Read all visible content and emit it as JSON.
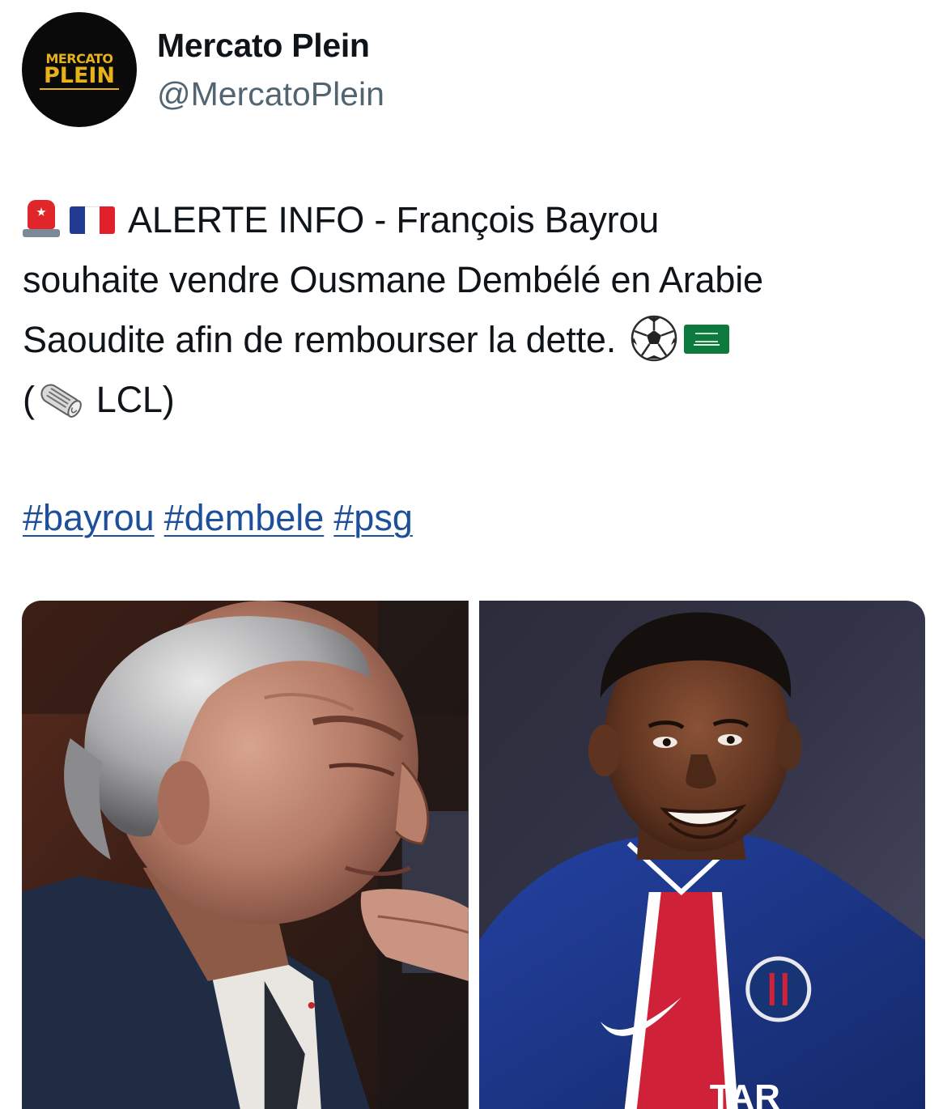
{
  "author": {
    "display_name": "Mercato Plein",
    "handle": "@MercatoPlein",
    "avatar_text_top": "MERCATO",
    "avatar_text_bottom": "PLEIN"
  },
  "tweet": {
    "line1": "ALERTE INFO - François Bayrou",
    "line2": "souhaite vendre Ousmane Dembélé en Arabie",
    "line3": "Saoudite afin de rembourser la dette.",
    "line4_open": "(",
    "source": "LCL)",
    "emojis": [
      "rotating-light-icon",
      "france-flag-icon",
      "soccer-ball-icon",
      "saudi-arabia-flag-icon",
      "rolled-newspaper-icon"
    ],
    "hashtags": [
      "#bayrou",
      "#dembele",
      "#psg"
    ]
  },
  "media": {
    "photos": [
      {
        "subject": "grey-haired man resting chin on hand"
      },
      {
        "subject": "smiling footballer in blue jersey"
      }
    ],
    "jersey_text": "TAR"
  },
  "colors": {
    "text": "#0f1419",
    "secondary_text": "#536471",
    "hashtag": "#1d4f9b",
    "avatar_bg": "#0a0a0a",
    "avatar_accent": "#e6b21a"
  }
}
